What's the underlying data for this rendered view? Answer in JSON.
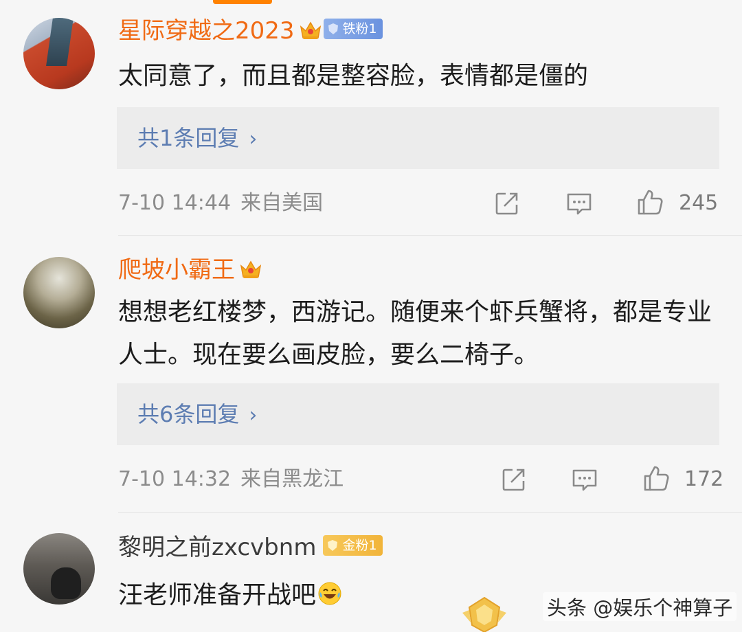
{
  "comments": [
    {
      "username": "星际穿越之2023",
      "fan_badge": "铁粉1",
      "text": "太同意了，而且都是整容脸，表情都是僵的",
      "replies_label": "共1条回复",
      "date_time": "7-10 14:44",
      "location": "来自美国",
      "likes": "245"
    },
    {
      "username": "爬坡小霸王",
      "text": "想想老红楼梦，西游记。随便来个虾兵蟹将，都是专业人士。现在要么画皮脸，要么二椅子。",
      "replies_label": "共6条回复",
      "date_time": "7-10 14:32",
      "location": "来自黑龙江",
      "likes": "172"
    },
    {
      "username": "黎明之前zxcvbnm",
      "fan_badge": "金粉1",
      "text": "汪老师准备开战吧"
    }
  ],
  "reply_chevron": "›",
  "icons": {
    "share": "share-icon",
    "comment": "comment-icon",
    "like": "thumbs-up-icon",
    "crown": "vip-crown-icon",
    "emoji": "laughing-tears-emoji"
  },
  "colors": {
    "vip_name": "#f06a14",
    "link": "#5d7db2",
    "meta": "#8c8c8c",
    "accent": "#ff8200"
  },
  "watermark": "头条 @娱乐个神算子"
}
